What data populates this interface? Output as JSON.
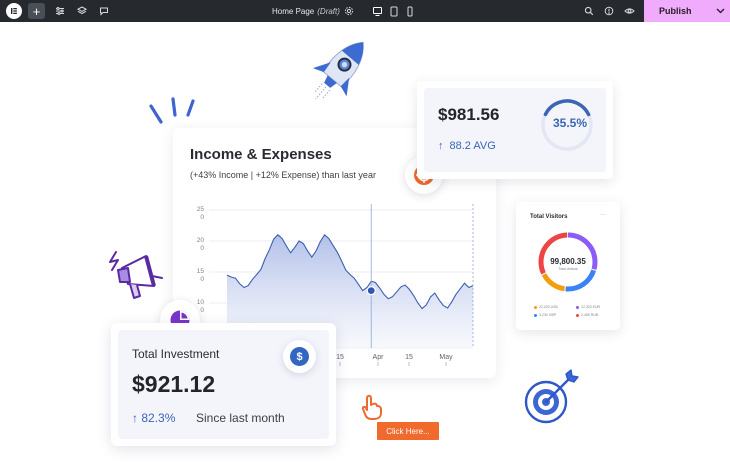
{
  "topbar": {
    "page_name": "Home Page",
    "page_status": "(Draft)",
    "publish_label": "Publish",
    "plus_label": "+",
    "icons": [
      "elementor-logo-icon",
      "plus-icon",
      "settings-sliders-icon",
      "layers-icon",
      "comments-icon",
      "page-settings-icon",
      "desktop-icon",
      "tablet-icon",
      "mobile-icon",
      "search-icon",
      "help-icon",
      "preview-eye-icon",
      "chevron-down-icon"
    ]
  },
  "chart": {
    "title": "Income & Expenses",
    "subtitle": "(+43% Income | +12% Expense) than last year"
  },
  "chart_data": {
    "type": "area",
    "title": "Income & Expenses",
    "y_ticks": [
      "25",
      "20",
      "15",
      "10"
    ],
    "y_tick_sub": "0",
    "ylim": [
      5,
      25
    ],
    "x_ticks": [
      "15",
      "Apr",
      "15",
      "May"
    ],
    "grid": true,
    "series": [
      {
        "values": [
          14.5,
          14.2,
          14.0,
          13.1,
          12.5,
          12.8,
          13.8,
          14.6,
          15.4,
          17.2,
          18.6,
          20.3,
          21.0,
          20.4,
          19.2,
          18.1,
          19.0,
          20.0,
          19.6,
          18.4,
          17.4,
          18.4,
          19.9,
          21.0,
          20.4,
          19.3,
          18.2,
          16.8,
          15.3,
          14.6,
          14.0,
          13.0,
          12.0,
          12.5,
          13.5,
          13.3,
          12.4,
          11.4,
          10.7,
          11.0,
          11.8,
          12.6,
          12.9,
          12.2,
          11.2,
          10.0,
          9.1,
          9.7,
          11.0,
          11.6,
          10.5,
          9.6,
          9.2,
          10.2,
          11.4,
          12.3,
          13.2,
          12.5,
          12.8
        ]
      }
    ],
    "highlight_point": {
      "x": 34,
      "y": 12.0
    },
    "colors": {
      "line": "#3b5fb0",
      "fill_top": "#aebde8",
      "fill_bottom": "#f2f4fb",
      "marker": "#2f57b0"
    }
  },
  "stat_card": {
    "amount": "$981.56",
    "avg_arrow": "↑",
    "avg_label": "88.2 AVG",
    "percent_label": "35.5%",
    "percent_value": 0.355,
    "ring_color": "#3a66b4",
    "ring_track": "#e3e7f3"
  },
  "visitors": {
    "title": "Total Visitors",
    "menu": "···",
    "total": "99,800.35",
    "sub_label": "Total visitors",
    "segments": [
      {
        "color": "#8b5cf6",
        "share": 0.3
      },
      {
        "color": "#3b82f6",
        "share": 0.22
      },
      {
        "color": "#f59e0b",
        "share": 0.16
      },
      {
        "color": "#ef4444",
        "share": 0.32
      }
    ],
    "legend": [
      {
        "label": "22,220 USD",
        "color": "#f59e0b"
      },
      {
        "label": "12,320 EUR",
        "color": "#8b5cf6"
      },
      {
        "label": "3,230 GBP",
        "color": "#3b82f6"
      },
      {
        "label": "2,455 RUB",
        "color": "#ef4444"
      }
    ]
  },
  "investment": {
    "title": "Total Investment",
    "amount": "$921.12",
    "pct_arrow": "↑",
    "pct": "82.3%",
    "since": "Since last month",
    "badge_symbol": "$"
  },
  "cta": {
    "label": "Click Here..."
  }
}
